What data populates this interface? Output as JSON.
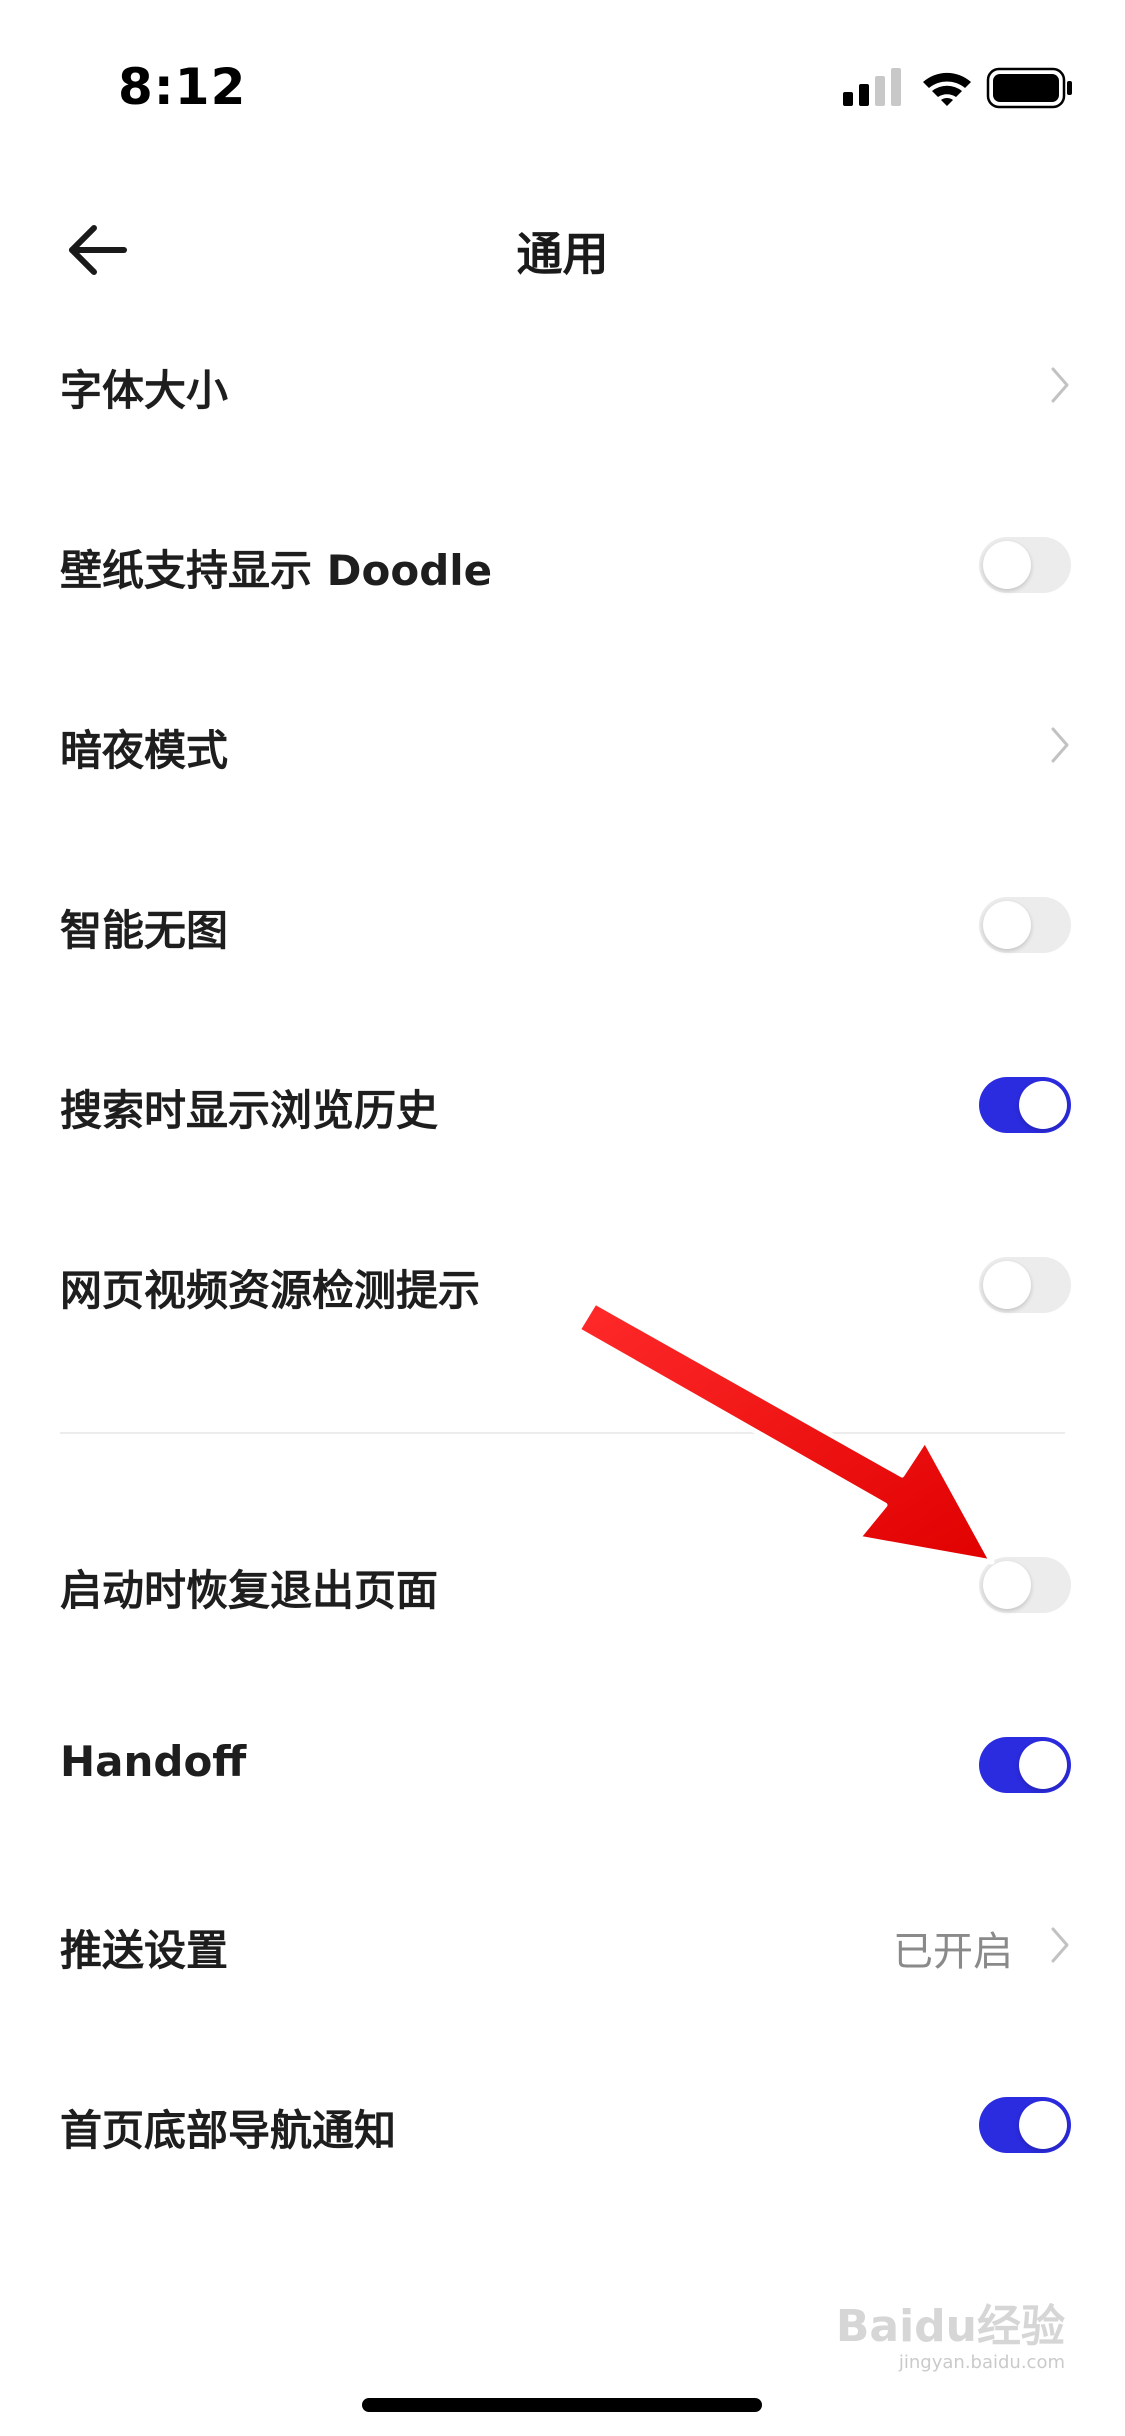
{
  "status_bar": {
    "time": "8:12",
    "icons": [
      "signal-icon",
      "wifi-icon",
      "battery-icon"
    ]
  },
  "nav": {
    "back_icon": "arrow-left-icon",
    "title": "通用"
  },
  "settings": {
    "font_size": {
      "label": "字体大小",
      "control": "chevron"
    },
    "wallpaper_doodle": {
      "label": "壁纸支持显示 Doodle",
      "control": "toggle",
      "on": false
    },
    "dark_mode": {
      "label": "暗夜模式",
      "control": "chevron"
    },
    "smart_no_image": {
      "label": "智能无图",
      "control": "toggle",
      "on": false
    },
    "search_history": {
      "label": "搜索时显示浏览历史",
      "control": "toggle",
      "on": true
    },
    "video_detect": {
      "label": "网页视频资源检测提示",
      "control": "toggle",
      "on": false
    },
    "restore_pages": {
      "label": "启动时恢复退出页面",
      "control": "toggle",
      "on": false
    },
    "handoff": {
      "label": "Handoff",
      "control": "toggle",
      "on": true
    },
    "push_settings": {
      "label": "推送设置",
      "value": "已开启",
      "control": "chevron"
    },
    "bottom_nav_notify": {
      "label": "首页底部导航通知",
      "control": "toggle",
      "on": true
    }
  },
  "colors": {
    "toggle_on": "#2b2bdf",
    "toggle_off": "#ececec",
    "annotation_arrow": "#ee0000"
  },
  "watermark": {
    "text": "Baidu经验",
    "sub": "jingyan.baidu.com"
  }
}
